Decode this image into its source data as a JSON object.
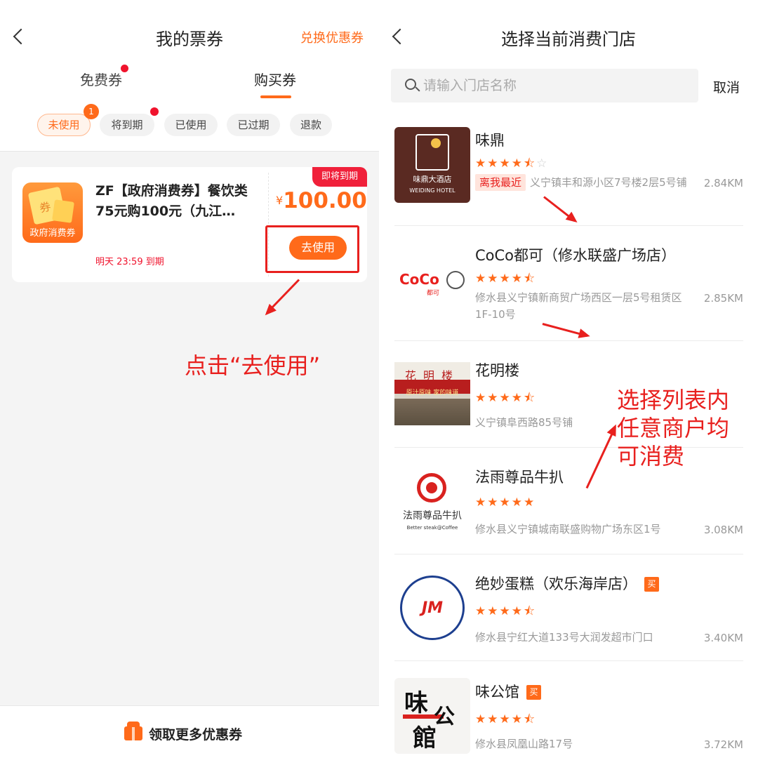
{
  "left": {
    "title": "我的票券",
    "exchange": "兑换优惠券",
    "tabs": [
      "免费券",
      "购买券"
    ],
    "filter_chips": [
      "未使用",
      "将到期",
      "已使用",
      "已过期",
      "退款"
    ],
    "unused_badge": "1",
    "coupon": {
      "icon_label": "政府消费券",
      "icon_char": "券",
      "name": "ZF【政府消费券】餐饮类75元购100元（九江…",
      "expire": "明天 23:59 到期",
      "tag": "即将到期",
      "currency": "¥",
      "price": "100.00",
      "use_button": "去使用"
    },
    "instruction": "点击“去使用”",
    "bottom_button": "领取更多优惠券"
  },
  "right": {
    "title": "选择当前消费门店",
    "search": {
      "placeholder": "请输入门店名称"
    },
    "cancel": "取消",
    "near_tag": "离我最近",
    "buy_tag": "买",
    "stores": [
      {
        "name": "味鼎",
        "rating": 4.5,
        "stars": "★★★★⯪",
        "off": "☆",
        "address": "义宁镇丰和源小区7号楼2层5号铺",
        "distance": "2.84KM",
        "logo": {
          "cn": "味鼎大酒店",
          "en": "WEIDING HOTEL"
        }
      },
      {
        "name": "CoCo都可（修水联盛广场店）",
        "rating": 4.5,
        "stars": "★★★★⯪",
        "address": "修水县义宁镇新商贸广场西区一层5号租赁区1F-10号",
        "distance": "2.85KM",
        "logo": {
          "text": "CoCo",
          "sub": "都可"
        }
      },
      {
        "name": "花明楼",
        "rating": 4.5,
        "stars": "★★★★⯪",
        "address": "义宁镇阜西路85号铺",
        "distance": "",
        "logo": {
          "sign": "花明楼",
          "slogan": "原汁原味 家的味道"
        }
      },
      {
        "name": "法雨尊品牛扒",
        "rating": 5,
        "stars": "★★★★★",
        "address": "修水县义宁镇城南联盛购物广场东区1号",
        "distance": "3.08KM",
        "logo": {
          "cn": "法雨尊品牛扒",
          "en": "Better steak@Coffee"
        }
      },
      {
        "name": "绝妙蛋糕（欢乐海岸店）",
        "rating": 4.5,
        "stars": "★★★★⯪",
        "address": "修水县宁红大道133号大润发超市门口",
        "distance": "3.40KM",
        "logo": {
          "mark": "JM"
        }
      },
      {
        "name": "味公馆",
        "rating": 4.5,
        "stars": "★★★★⯪",
        "address": "修水县凤凰山路17号",
        "distance": "3.72KM",
        "logo": {
          "c1": "味",
          "c2": "公",
          "c3": "館"
        }
      }
    ],
    "instruction": [
      "选择列表内",
      "任意商户均",
      "可消费"
    ]
  },
  "colors": {
    "accent": "#ff6a1a",
    "annotation_red": "#e8201e",
    "badge_red": "#f0132d"
  }
}
